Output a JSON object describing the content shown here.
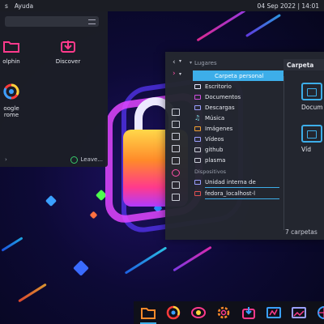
{
  "top_panel": {
    "menu_partial": "s",
    "menu_help": "Ayuda",
    "datetime": "04 Sep 2022 | 14:01"
  },
  "launcher": {
    "apps": [
      {
        "label": "olphin",
        "icon": "folder-icon"
      },
      {
        "label": "Discover",
        "icon": "discover-icon"
      },
      {
        "label": "oogle\nrome",
        "icon": "chrome-icon"
      }
    ],
    "leave_label": "Leave..."
  },
  "file_manager": {
    "places_header": "Lugares",
    "breadcrumb": "Carpeta",
    "places": [
      {
        "label": "Carpeta personal",
        "icon": "home-icon",
        "color": "#3daee9",
        "selected": true
      },
      {
        "label": "Escritorio",
        "icon": "desktop-icon",
        "color": "#e8e8ff"
      },
      {
        "label": "Documentos",
        "icon": "documents-icon",
        "color": "#d04de0"
      },
      {
        "label": "Descargas",
        "icon": "downloads-icon",
        "color": "#9aa0ff"
      },
      {
        "label": "Música",
        "icon": "music-icon",
        "color": "#7ee0e8"
      },
      {
        "label": "Imágenes",
        "icon": "pictures-icon",
        "color": "#f0a030"
      },
      {
        "label": "Vídeos",
        "icon": "videos-icon",
        "color": "#9aa0ff"
      },
      {
        "label": "github",
        "icon": "folder-icon",
        "color": "#c9ccd6"
      },
      {
        "label": "plasma",
        "icon": "folder-icon",
        "color": "#c9ccd6"
      }
    ],
    "devices_header": "Dispositivos",
    "devices": [
      {
        "label": "Unidad interna de",
        "icon": "drive-icon"
      },
      {
        "label": "fedora_localhost-l",
        "icon": "drive-icon"
      }
    ],
    "content_items": [
      {
        "label": "Docum",
        "icon": "documents-folder-icon"
      },
      {
        "label": "Víd",
        "icon": "videos-folder-icon"
      }
    ],
    "status": "7 carpetas"
  },
  "taskbar": {
    "items": [
      "dolphin-icon",
      "chrome-icon",
      "discover-icon",
      "settings-icon",
      "software-icon",
      "monitor-icon",
      "image-viewer-icon",
      "browser-icon"
    ]
  }
}
